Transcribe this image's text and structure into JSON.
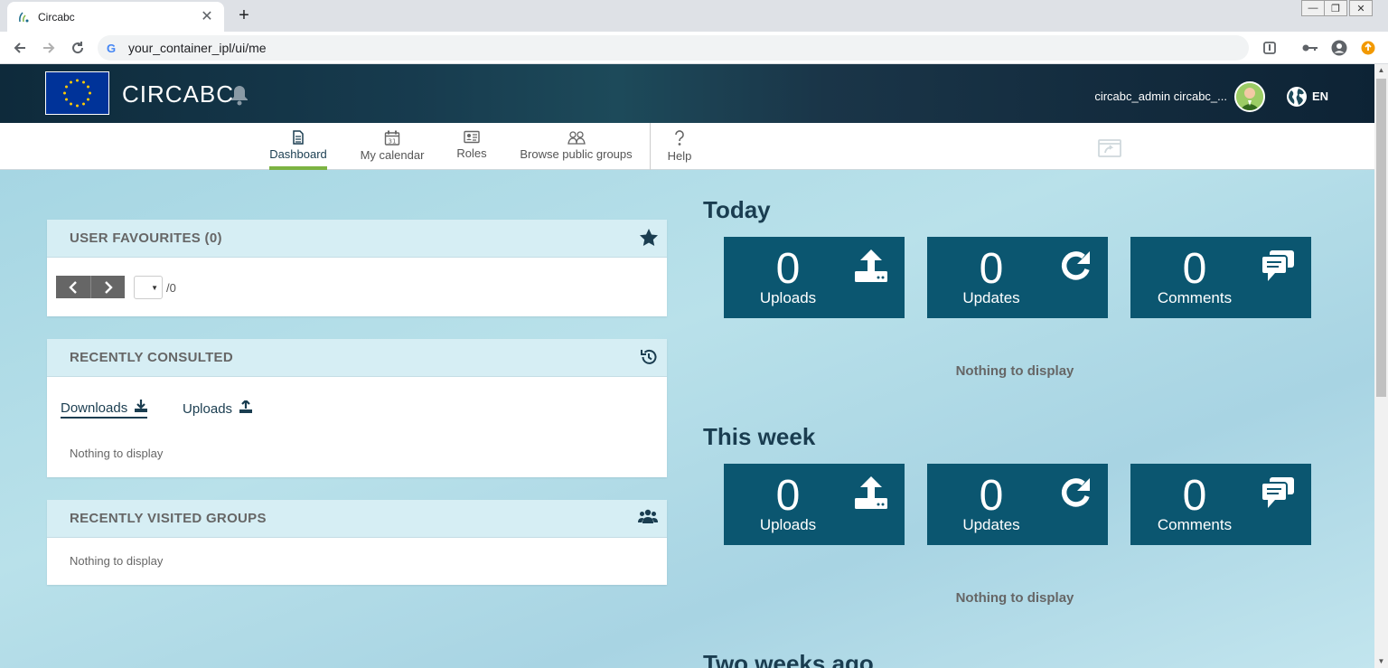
{
  "browser": {
    "tab_title": "Circabc",
    "url": "your_container_ipl/ui/me"
  },
  "header": {
    "app_title": "CIRCABC",
    "username": "circabc_admin circabc_...",
    "language": "EN"
  },
  "nav": {
    "dashboard": "Dashboard",
    "calendar": "My calendar",
    "calendar_day": "31",
    "roles": "Roles",
    "browse": "Browse public groups",
    "help": "Help"
  },
  "favourites": {
    "title": "USER FAVOURITES (0)",
    "total": "/0"
  },
  "recent": {
    "title": "RECENTLY CONSULTED",
    "downloads": "Downloads",
    "uploads": "Uploads",
    "empty": "Nothing to display"
  },
  "groups": {
    "title": "RECENTLY VISITED GROUPS",
    "empty": "Nothing to display"
  },
  "today": {
    "title": "Today",
    "uploads_count": "0",
    "uploads_label": "Uploads",
    "updates_count": "0",
    "updates_label": "Updates",
    "comments_count": "0",
    "comments_label": "Comments",
    "empty": "Nothing to display"
  },
  "week": {
    "title": "This week",
    "uploads_count": "0",
    "uploads_label": "Uploads",
    "updates_count": "0",
    "updates_label": "Updates",
    "comments_count": "0",
    "comments_label": "Comments",
    "empty": "Nothing to display"
  },
  "two_weeks": {
    "title": "Two weeks ago"
  },
  "colors": {
    "primary": "#0b5670",
    "accent": "#7cb342",
    "title": "#1a3d50"
  }
}
